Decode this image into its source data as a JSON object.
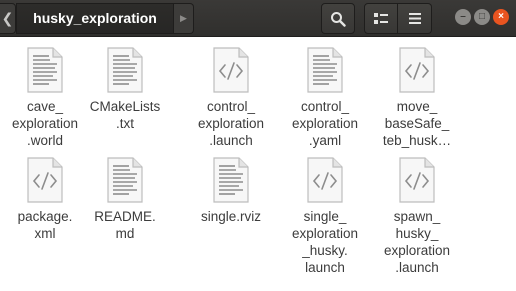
{
  "header": {
    "prev_arrow": "❮",
    "current_folder": "husky_exploration",
    "next_arrow": "▶"
  },
  "toolbar": {
    "search_icon": "search-icon",
    "view_icon": "view-options-icon",
    "menu_icon": "hamburger-menu-icon"
  },
  "window_controls": {
    "minimize": "–",
    "maximize": "□",
    "close": "×",
    "close_color": "#e95420"
  },
  "files": [
    {
      "name": "cave_\nexploration\n.world",
      "icon": "text-document-icon"
    },
    {
      "name": "CMakeLists\n.txt",
      "icon": "text-document-icon"
    },
    {
      "name": "control_\nexploration\n.launch",
      "icon": "xml-document-icon"
    },
    {
      "name": "control_\nexploration\n.yaml",
      "icon": "text-document-icon"
    },
    {
      "name": "move_\nbaseSafe_\nteb_husk…",
      "icon": "xml-document-icon"
    },
    {
      "name": "package.\nxml",
      "icon": "xml-document-icon"
    },
    {
      "name": "README.\nmd",
      "icon": "text-document-icon"
    },
    {
      "name": "single.rviz",
      "icon": "text-document-icon"
    },
    {
      "name": "single_\nexploration\n_husky.\nlaunch",
      "icon": "xml-document-icon"
    },
    {
      "name": "spawn_\nhusky_\nexploration\n.launch",
      "icon": "xml-document-icon"
    }
  ]
}
